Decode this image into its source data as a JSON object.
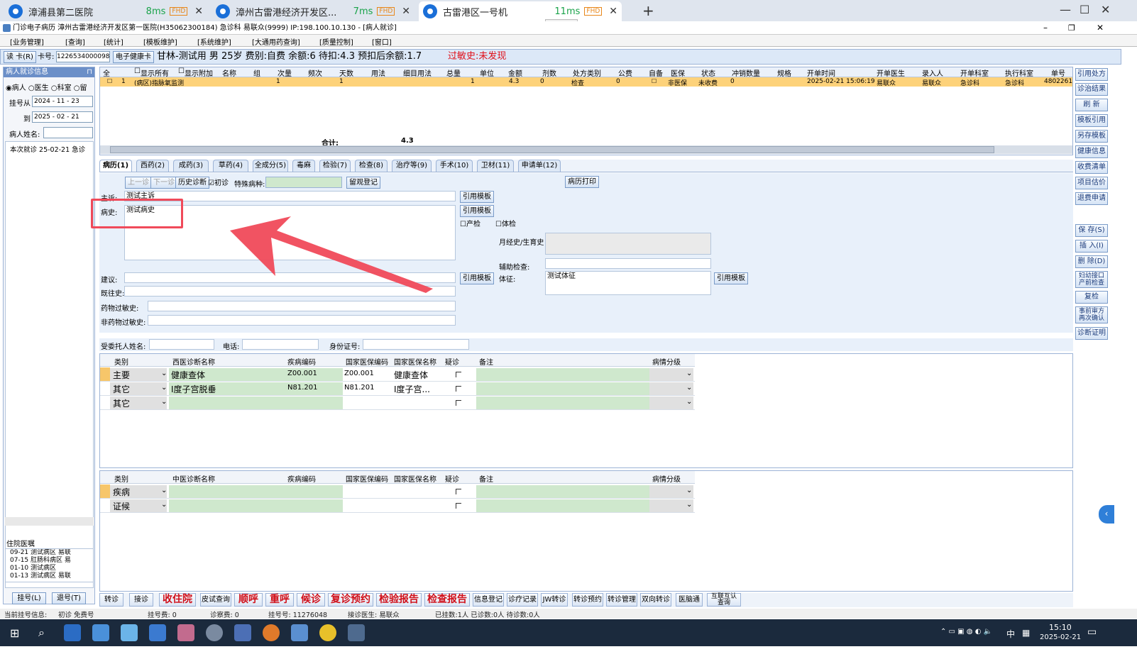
{
  "remote_tabs": [
    {
      "title": "漳浦县第二医院",
      "latency": "8ms",
      "badge": "FHD"
    },
    {
      "title": "漳州古雷港经济开发区...",
      "latency": "7ms",
      "badge": "FHD"
    },
    {
      "title": "古雷港区一号机",
      "latency": "11ms",
      "badge": "FHD"
    }
  ],
  "app": {
    "title": "门诊电子病历  漳州古雷港经济开发区第一医院(H35062300184)  急诊科  易联众(9999)  IP:198.100.10.130 - [病人就诊]"
  },
  "menu": [
    "[业务管理]",
    "[查询]",
    "[统计]",
    "[模板维护]",
    "[系统维护]",
    "[大通用药查询]",
    "[质量控制]",
    "[窗口]"
  ],
  "infobar": {
    "read_card": "读 卡(R)",
    "card_label": "卡号:",
    "card_no": "12265340000989750",
    "ehealth": "电子健康卡",
    "patient": "甘林-测试用  男  25岁  费别:自费  余额:6  待扣:4.3  预扣后余额:1.7",
    "allergy": "过敏史:未发现"
  },
  "left": {
    "header": "病人就诊信息",
    "radios": [
      "病人",
      "医生",
      "科室",
      "留"
    ],
    "reg_from_label": "挂号从",
    "reg_from": "2024 - 11 - 23",
    "reg_to_label": "到",
    "reg_to": "2025 - 02 - 21",
    "name_label": "病人姓名:",
    "tree_item": "本次就诊  25-02-21  急诊",
    "inpatient_header": "住院医嘱",
    "inpatient": [
      "09-21  测试病区  易联",
      "07-15  肛肠科病区  易",
      "01-10  测试病区",
      "01-13  测试病区  易联"
    ],
    "btn_reg": "挂号(L)",
    "btn_unreg": "退号(T)"
  },
  "top_grid": {
    "headers": [
      "全",
      "",
      "显示所有",
      "显示附加",
      "名称",
      "组",
      "次量",
      "频次",
      "天数",
      "用法",
      "细目用法",
      "总量",
      "单位",
      "金额",
      "剂数",
      "处方类别",
      "公费",
      "自备",
      "医保",
      "状态",
      "冲销数量",
      "规格",
      "开单时间",
      "开单医生",
      "录入人",
      "开单科室",
      "执行科室",
      "单号"
    ],
    "row": {
      "idx": "1",
      "name": "(病区)指脉氧监测",
      "qty": "1",
      "days": "1",
      "total": "1",
      "amount": "4.3",
      "doses": "0",
      "type": "检查",
      "gf": "0",
      "yb": "非医保",
      "status": "未收费",
      "cx": "0",
      "time": "2025-02-21 15:06:19",
      "doctor": "易联众",
      "entry": "易联众",
      "dept": "急诊科",
      "exec": "急诊科",
      "no": "4802261"
    },
    "total_label": "合计:",
    "total_value": "4.3"
  },
  "right_buttons": [
    "引用处方",
    "诊治结果",
    "刷 新",
    "模板引用",
    "另存模板",
    "健康信息",
    "收费清单",
    "项目估价",
    "退费申请",
    "保 存(S)",
    "插 入(I)",
    "删 除(D)",
    "妇幼接口\n产前检查",
    "复检",
    "事前审方\n再次确认",
    "诊断证明"
  ],
  "record_tabs": [
    "病历(1)",
    "西药(2)",
    "成药(3)",
    "草药(4)",
    "全成分(5)",
    "毒麻",
    "检验(7)",
    "检查(8)",
    "治疗等(9)",
    "手术(10)",
    "卫材(11)",
    "申请单(12)"
  ],
  "form": {
    "prev": "上一诊",
    "next": "下一诊",
    "history": "历史诊断",
    "first_visit": "初诊",
    "special_label": "特殊病种:",
    "leave_obs": "留观登记",
    "print": "病历打印",
    "complaint_label": "主诉:",
    "complaint": "测试主诉",
    "history_label": "病史:",
    "history_value": "测试病史",
    "cite": "引用模板",
    "prenatal": "产检",
    "physical": "体检",
    "menstrual_label": "月经史/生育史",
    "aux_label": "辅助检查:",
    "sign_label": "体征:",
    "sign_value": "测试体征",
    "advice_label": "建议:",
    "past_label": "既往史:",
    "drug_allergy_label": "药物过敏史:",
    "nondrug_allergy_label": "非药物过敏史:"
  },
  "delegate": {
    "name_label": "受委托人姓名:",
    "phone_label": "电话:",
    "id_label": "身份证号:"
  },
  "west_diag": {
    "headers": [
      "类别",
      "西医诊断名称",
      "疾病编码",
      "国家医保编码",
      "国家医保名称",
      "疑诊",
      "备注",
      "病情分级"
    ],
    "rows": [
      {
        "type": "主要",
        "name": "健康查体",
        "code": "Z00.001",
        "ncode": "Z00.001",
        "nname": "健康查体"
      },
      {
        "type": "其它",
        "name": "Ⅰ度子宫脱垂",
        "code": "N81.201",
        "ncode": "N81.201",
        "nname": "Ⅰ度子宫..."
      },
      {
        "type": "其它",
        "name": "",
        "code": "",
        "ncode": "",
        "nname": ""
      }
    ]
  },
  "tcm_diag": {
    "headers": [
      "类别",
      "中医诊断名称",
      "疾病编码",
      "国家医保编码",
      "国家医保名称",
      "疑诊",
      "备注",
      "病情分级"
    ],
    "rows": [
      {
        "type": "疾病"
      },
      {
        "type": "证候"
      }
    ]
  },
  "bottom_buttons": [
    {
      "label": "转诊",
      "red": false
    },
    {
      "label": "接诊",
      "red": false
    },
    {
      "label": "收住院",
      "red": true
    },
    {
      "label": "皮试查询",
      "red": false
    },
    {
      "label": "顺呼",
      "red": true
    },
    {
      "label": "重呼",
      "red": true
    },
    {
      "label": "候诊",
      "red": true
    },
    {
      "label": "复诊预约",
      "red": true
    },
    {
      "label": "检验报告",
      "red": true
    },
    {
      "label": "检查报告",
      "red": true
    },
    {
      "label": "信息登记",
      "red": false
    },
    {
      "label": "诊疗记录",
      "red": false
    },
    {
      "label": "JW转诊",
      "red": false
    },
    {
      "label": "转诊预约",
      "red": false
    },
    {
      "label": "转诊管理",
      "red": false
    },
    {
      "label": "双向转诊",
      "red": false
    },
    {
      "label": "医脑通",
      "red": false
    },
    {
      "label": "互联互认\n查询",
      "red": false
    }
  ],
  "status": {
    "current": "当前挂号信息:",
    "first": "初诊 免费号",
    "reg_fee": "挂号费:  0",
    "treat_fee": "诊察费:  0",
    "reg_no": "挂号号:  11276048",
    "doctor": "接诊医生:  易联众",
    "counts": "已挂数:1人  已诊数:0人  待诊数:0人"
  },
  "taskbar": {
    "time": "15:10",
    "date": "2025-02-21",
    "ime": "中"
  },
  "colors": {
    "annotation": "#f04a5a",
    "accent": "#1a6fd8",
    "row_highlight": "#fdd27a",
    "diag_green": "#cfe8cd"
  }
}
